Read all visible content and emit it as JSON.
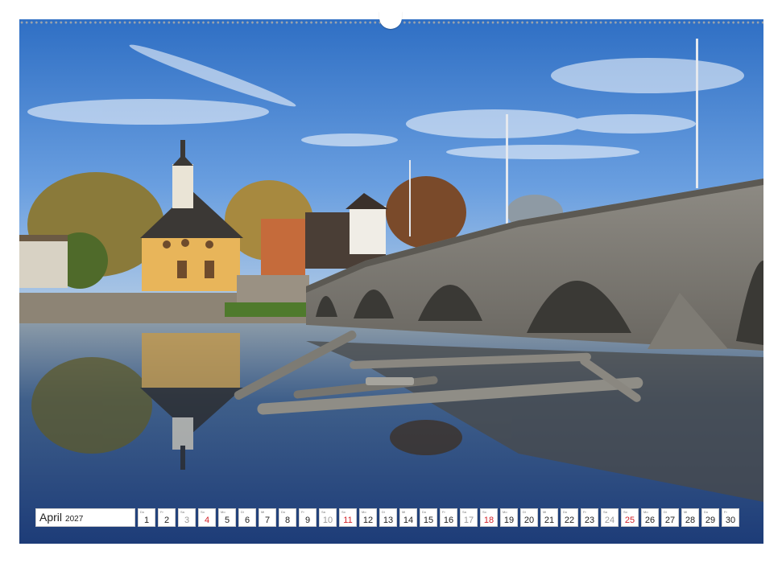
{
  "calendar": {
    "month": "April",
    "year": "2027",
    "colors": {
      "weekday": "#222222",
      "saturday": "#9a9a9a",
      "sunday": "#d2232a"
    },
    "days": [
      {
        "wd": "Do",
        "num": "1",
        "type": "weekday"
      },
      {
        "wd": "Fr",
        "num": "2",
        "type": "weekday"
      },
      {
        "wd": "Sa",
        "num": "3",
        "type": "saturday"
      },
      {
        "wd": "So",
        "num": "4",
        "type": "sunday"
      },
      {
        "wd": "Mo",
        "num": "5",
        "type": "weekday"
      },
      {
        "wd": "Di",
        "num": "6",
        "type": "weekday"
      },
      {
        "wd": "Mi",
        "num": "7",
        "type": "weekday"
      },
      {
        "wd": "Do",
        "num": "8",
        "type": "weekday"
      },
      {
        "wd": "Fr",
        "num": "9",
        "type": "weekday"
      },
      {
        "wd": "Sa",
        "num": "10",
        "type": "saturday"
      },
      {
        "wd": "So",
        "num": "11",
        "type": "sunday"
      },
      {
        "wd": "Mo",
        "num": "12",
        "type": "weekday"
      },
      {
        "wd": "Di",
        "num": "13",
        "type": "weekday"
      },
      {
        "wd": "Mi",
        "num": "14",
        "type": "weekday"
      },
      {
        "wd": "Do",
        "num": "15",
        "type": "weekday"
      },
      {
        "wd": "Fr",
        "num": "16",
        "type": "weekday"
      },
      {
        "wd": "Sa",
        "num": "17",
        "type": "saturday"
      },
      {
        "wd": "So",
        "num": "18",
        "type": "sunday"
      },
      {
        "wd": "Mo",
        "num": "19",
        "type": "weekday"
      },
      {
        "wd": "Di",
        "num": "20",
        "type": "weekday"
      },
      {
        "wd": "Mi",
        "num": "21",
        "type": "weekday"
      },
      {
        "wd": "Do",
        "num": "22",
        "type": "weekday"
      },
      {
        "wd": "Fr",
        "num": "23",
        "type": "weekday"
      },
      {
        "wd": "Sa",
        "num": "24",
        "type": "saturday"
      },
      {
        "wd": "So",
        "num": "25",
        "type": "sunday"
      },
      {
        "wd": "Mo",
        "num": "26",
        "type": "weekday"
      },
      {
        "wd": "Di",
        "num": "27",
        "type": "weekday"
      },
      {
        "wd": "Mi",
        "num": "28",
        "type": "weekday"
      },
      {
        "wd": "Do",
        "num": "29",
        "type": "weekday"
      },
      {
        "wd": "Fr",
        "num": "30",
        "type": "weekday"
      }
    ]
  }
}
